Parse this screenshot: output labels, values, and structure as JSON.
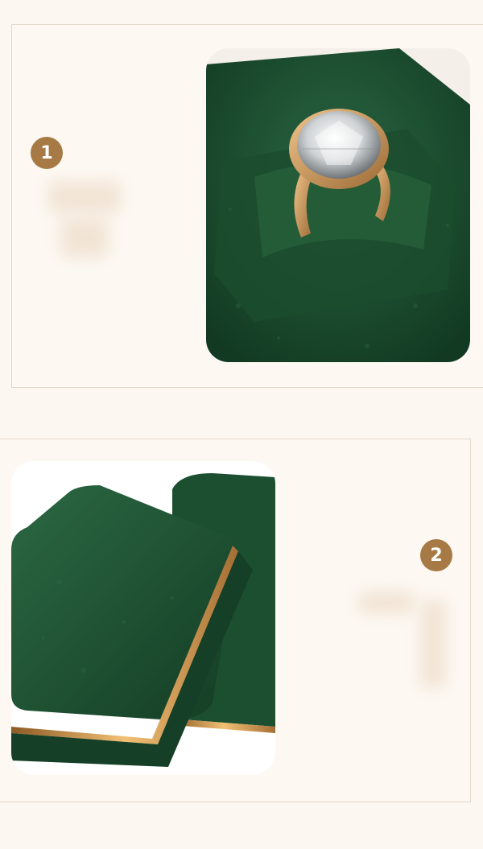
{
  "sections": [
    {
      "number": "1",
      "image": "ring-in-green-velvet-box-photo"
    },
    {
      "number": "2",
      "image": "closed-green-velvet-boxes-photo"
    }
  ],
  "colors": {
    "background": "#fcf7f1",
    "badge": "#a77a45",
    "velvet": "#1f5233",
    "gold_trim": "#c8913e"
  }
}
